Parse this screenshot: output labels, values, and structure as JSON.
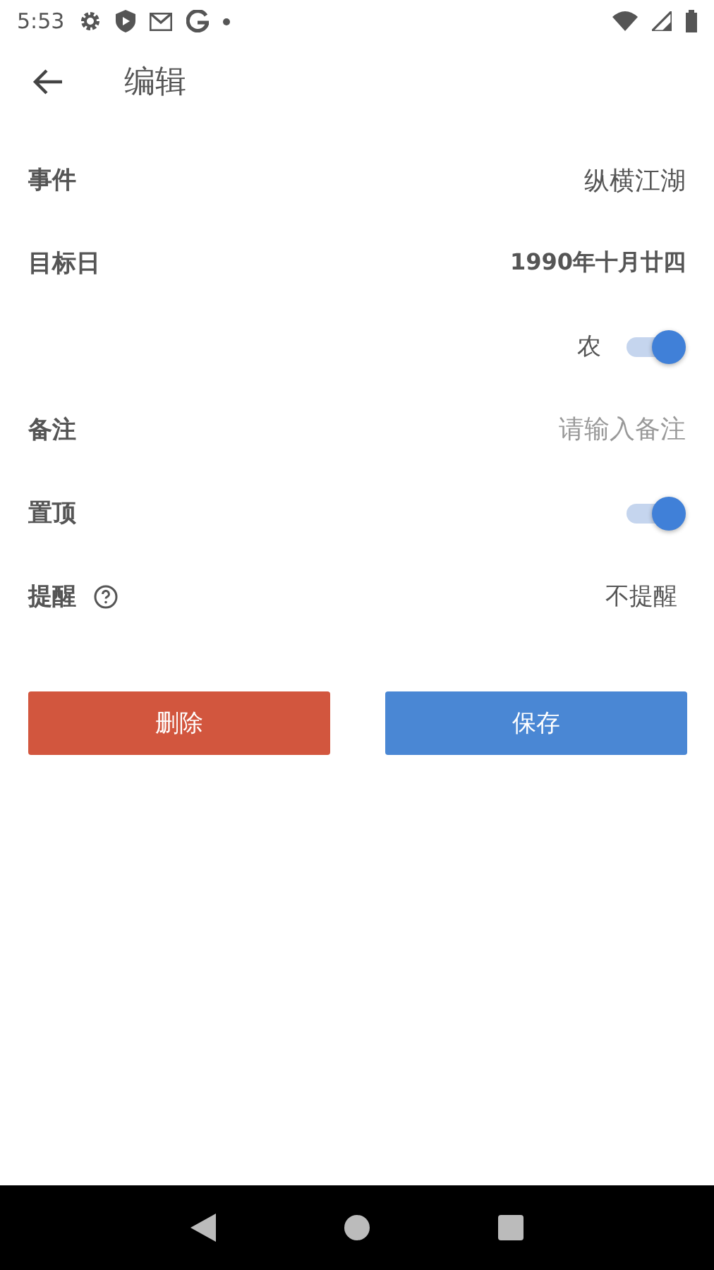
{
  "status_bar": {
    "time": "5:53"
  },
  "app_bar": {
    "title": "编辑"
  },
  "rows": [
    {
      "kind": "text",
      "label": "事件",
      "value": "纵横江湖",
      "bold": false
    },
    {
      "kind": "text",
      "label": "目标日",
      "value": "1990年十月廿四",
      "bold": true
    },
    {
      "kind": "toggle",
      "side_label": "农",
      "on": true
    },
    {
      "kind": "field",
      "label": "备注",
      "placeholder": "请输入备注"
    },
    {
      "kind": "toggle",
      "label": "置顶",
      "on": true
    },
    {
      "kind": "select",
      "label": "提醒",
      "help": true,
      "value": "不提醒"
    }
  ],
  "buttons": [
    {
      "label": "删除",
      "kind": "danger"
    },
    {
      "label": "保存",
      "kind": "primary"
    }
  ]
}
